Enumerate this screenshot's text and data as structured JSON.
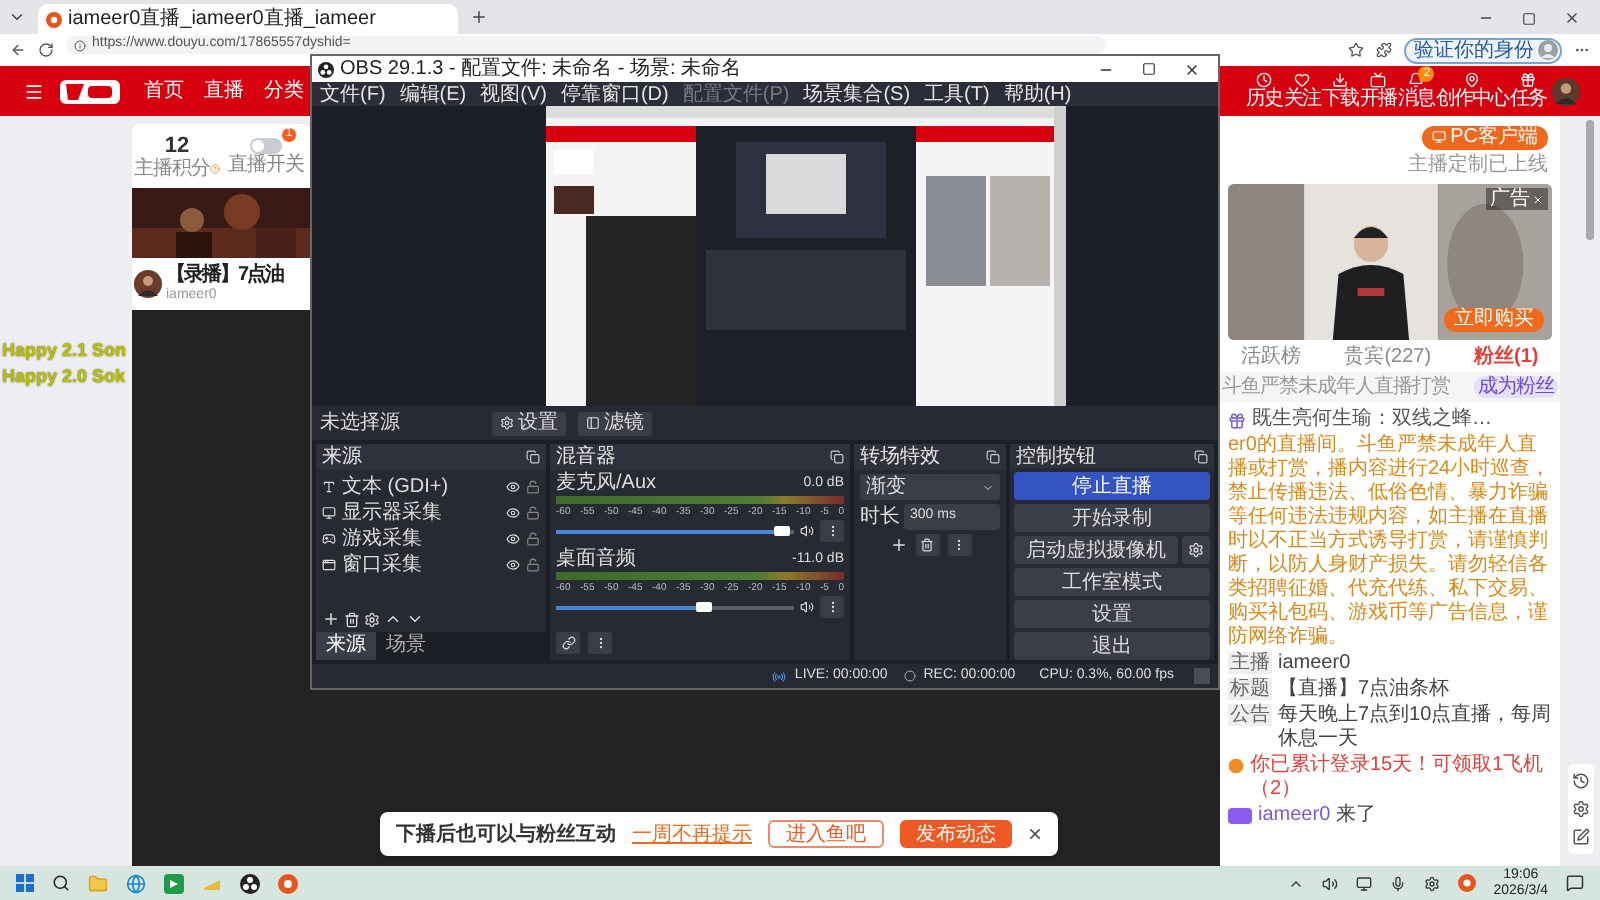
{
  "browser": {
    "tab_title": "iameer0直播_iameer0直播_iameer",
    "url": "https://www.douyu.com/17865557dyshid=",
    "verify_label": "验证你的身份"
  },
  "site_header": {
    "nav": [
      "首页",
      "直播",
      "分类"
    ],
    "actions": [
      {
        "kind": "history",
        "label": "历史"
      },
      {
        "kind": "follow",
        "label": "关注"
      },
      {
        "kind": "download",
        "label": "下载"
      },
      {
        "kind": "broadcast",
        "label": "开播"
      },
      {
        "kind": "messages",
        "label": "消息",
        "badge": "2"
      },
      {
        "kind": "creator",
        "label": "创作中心"
      },
      {
        "kind": "tasks",
        "label": "任务"
      }
    ]
  },
  "overlay_text": [
    "Happy 2.1 Son",
    "Happy 2.0 Sok"
  ],
  "streamer_card": {
    "score": "12",
    "score_label": "主播积分",
    "switch_label": "直播开关",
    "switch_on": false,
    "switch_badge": "1"
  },
  "room": {
    "title": "【录播】7点油",
    "host": "iameer0"
  },
  "side_panel": {
    "client_button": "PC客户端",
    "client_note": "主播定制已上线",
    "ad_label": "广告",
    "ad_button": "立即购买",
    "tabs": [
      {
        "label": "活跃榜",
        "selected": false
      },
      {
        "label": "贵宾(227)",
        "selected": false
      },
      {
        "label": "粉丝(1)",
        "selected": true
      }
    ],
    "notice": "斗鱼严禁未成年人直播打赏",
    "fan_button": "成为粉丝"
  },
  "chat": [
    {
      "kind": "gift",
      "text": "既生亮何生瑜：双线之蜂…"
    },
    {
      "kind": "warning",
      "text": "er0的直播间。斗鱼严禁未成年人直播或打赏，播内容进行24小时巡查，禁止传播违法、低俗色情、暴力诈骗等任何违法违规内容，如主播在直播时以不正当方式诱导打赏，请谨慎判断，以防人身财产损失。请勿轻信各类招聘征婚、代充代练、私下交易、购买礼包码、游戏币等广告信息，谨防网络诈骗。"
    },
    {
      "kind": "info",
      "tag": "主播",
      "text": "iameer0"
    },
    {
      "kind": "info",
      "tag": "标题",
      "text": "【直播】7点油条杯"
    },
    {
      "kind": "info",
      "tag": "公告",
      "text": "每天晚上7点到10点直播，每周休息一天"
    },
    {
      "kind": "login",
      "text": "你已累计登录15天！可领取1飞机（2）"
    },
    {
      "kind": "enter",
      "user": "iameer0",
      "text": "来了"
    }
  ],
  "obs": {
    "title": "OBS 29.1.3 - 配置文件: 未命名 - 场景: 未命名",
    "menu": [
      {
        "label": "文件(F)",
        "disabled": false
      },
      {
        "label": "编辑(E)",
        "disabled": false
      },
      {
        "label": "视图(V)",
        "disabled": false
      },
      {
        "label": "停靠窗口(D)",
        "disabled": false
      },
      {
        "label": "配置文件(P)",
        "disabled": true
      },
      {
        "label": "场景集合(S)",
        "disabled": false
      },
      {
        "label": "工具(T)",
        "disabled": false
      },
      {
        "label": "帮助(H)",
        "disabled": false
      }
    ],
    "selection": "未选择源",
    "selection_buttons": [
      {
        "kind": "settings",
        "label": "设置"
      },
      {
        "kind": "filters",
        "label": "滤镜"
      }
    ],
    "sources": {
      "title": "来源",
      "items": [
        {
          "kind": "text",
          "name": "文本 (GDI+)",
          "visible": true,
          "locked": false
        },
        {
          "kind": "display",
          "name": "显示器采集",
          "visible": true,
          "locked": false
        },
        {
          "kind": "game",
          "name": "游戏采集",
          "visible": true,
          "locked": false
        },
        {
          "kind": "window",
          "name": "窗口采集",
          "visible": true,
          "locked": false
        }
      ],
      "tabs": [
        {
          "label": "来源",
          "selected": true
        },
        {
          "label": "场景",
          "selected": false
        }
      ]
    },
    "mixer": {
      "title": "混音器",
      "channels": [
        {
          "name": "麦克风/Aux",
          "reading": "0.0 dB",
          "level": 0.95,
          "ticks": [
            "-60",
            "-55",
            "-50",
            "-45",
            "-40",
            "-35",
            "-30",
            "-25",
            "-20",
            "-15",
            "-10",
            "-5",
            "0"
          ]
        },
        {
          "name": "桌面音频",
          "reading": "-11.0 dB",
          "level": 0.62,
          "ticks": [
            "-60",
            "-55",
            "-50",
            "-45",
            "-40",
            "-35",
            "-30",
            "-25",
            "-20",
            "-15",
            "-10",
            "-5",
            "0"
          ]
        }
      ]
    },
    "transitions": {
      "title": "转场特效",
      "transition": "渐变",
      "duration_label": "时长",
      "duration": "300 ms"
    },
    "controls": {
      "title": "控制按钮",
      "buttons": [
        {
          "label": "停止直播",
          "active": true,
          "settings": false
        },
        {
          "label": "开始录制",
          "active": false,
          "settings": false
        },
        {
          "label": "启动虚拟摄像机",
          "active": false,
          "settings": true
        },
        {
          "label": "工作室模式",
          "active": false,
          "settings": false
        },
        {
          "label": "设置",
          "active": false,
          "settings": false
        },
        {
          "label": "退出",
          "active": false,
          "settings": false
        }
      ]
    },
    "status": {
      "live": "LIVE: 00:00:00",
      "rec": "REC: 00:00:00",
      "cpu": "CPU: 0.3%, 60.00 fps"
    }
  },
  "notification": {
    "text": "下播后也可以与粉丝互动",
    "link": "一周不再提示",
    "buttons": [
      {
        "label": "进入鱼吧",
        "kind": "outline"
      },
      {
        "label": "发布动态",
        "kind": "primary"
      }
    ],
    "close": "×"
  },
  "taskbar": {
    "time": "19:06",
    "date": "2026/3/4"
  }
}
